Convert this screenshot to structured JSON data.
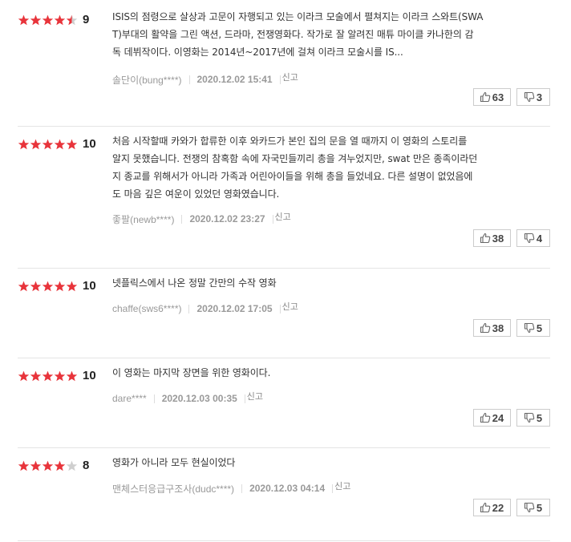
{
  "colors": {
    "star_on": "#e8343b",
    "star_off": "#cfcfcf"
  },
  "reviews": [
    {
      "stars": 4.5,
      "score": "9",
      "lines": [
        "ISIS의 점령으로 살상과 고문이 자행되고 있는 이라크 모술에서 펼쳐지는 이라크 스와트(SWA",
        "T)부대의 활약을 그린 액션, 드라마, 전쟁영화다. 작가로 잘 알려진 매튜 마이클 카나한의 감",
        "독 데뷔작이다. 이영화는 2014년~2017년에 걸쳐 이라크 모술시를 IS..."
      ],
      "author": "솔단이(bung****)",
      "date": "2020.12.02 15:41",
      "report": "신고",
      "up": "63",
      "down": "3"
    },
    {
      "stars": 5,
      "score": "10",
      "lines": [
        "처음 시작할때 카와가 합류한 이후 와카드가 본인 집의 문을 열 때까지 이 영화의 스토리를",
        "알지 못했습니다. 전쟁의 참혹함 속에 자국민들끼리 총을 겨누었지만, swat 만은 종족이라던",
        "지 종교를 위해서가 아니라 가족과 어린아이들을 위해 총을 들었네요. 다른 설명이 없었음에",
        "도 마음 깊은 여운이 있었던 영화였습니다."
      ],
      "author": "좋팔(newb****)",
      "date": "2020.12.02 23:27",
      "report": "신고",
      "up": "38",
      "down": "4"
    },
    {
      "stars": 5,
      "score": "10",
      "lines": [
        "넷플릭스에서 나온 정말 간만의 수작 영화"
      ],
      "author": "chaffe(sws6****)",
      "date": "2020.12.02 17:05",
      "report": "신고",
      "up": "38",
      "down": "5"
    },
    {
      "stars": 5,
      "score": "10",
      "lines": [
        "이 영화는 마지막 장면을 위한 영화이다."
      ],
      "author": "dare****",
      "date": "2020.12.03 00:35",
      "report": "신고",
      "up": "24",
      "down": "5"
    },
    {
      "stars": 4,
      "score": "8",
      "lines": [
        "영화가 아니라 모두 현실이었다"
      ],
      "author": "맨체스터응급구조사(dudc****)",
      "date": "2020.12.03 04:14",
      "report": "신고",
      "up": "22",
      "down": "5"
    }
  ]
}
